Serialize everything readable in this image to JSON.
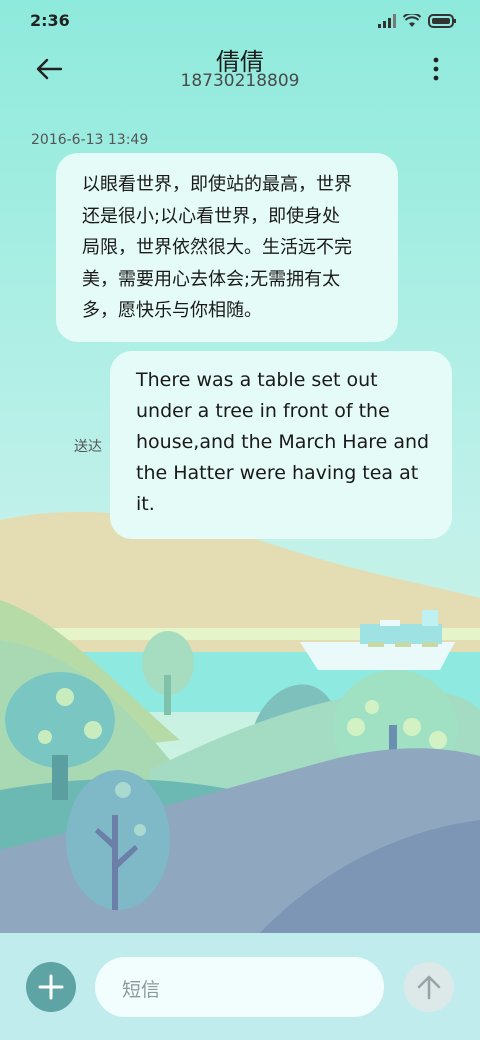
{
  "status_bar": {
    "time": "2:36"
  },
  "header": {
    "contact_name": "倩倩",
    "phone": "18730218809"
  },
  "messages": [
    {
      "timestamp": "2016-6-13 13:49",
      "lines": [
        "以眼看世界，即使站的最高，世界",
        "还是很小;以心看世界，即使身处",
        "局限，世界依然很大。生活远不完",
        "美，需要用心去体会;无需拥有太",
        "多，愿快乐与你相随。"
      ]
    },
    {
      "status": "送达",
      "lines": [
        "There was a table set out",
        "under a tree in front of the",
        "house,and the March Hare and",
        "the Hatter were having tea at",
        "it."
      ]
    }
  ],
  "composer": {
    "placeholder": "短信"
  },
  "colors": {
    "bubble": "#e5fbf7",
    "accent": "#5ea4a5"
  },
  "icons": [
    "back-arrow-icon",
    "more-vertical-icon",
    "signal-icon",
    "wifi-icon",
    "battery-icon",
    "plus-icon",
    "send-arrow-icon"
  ]
}
